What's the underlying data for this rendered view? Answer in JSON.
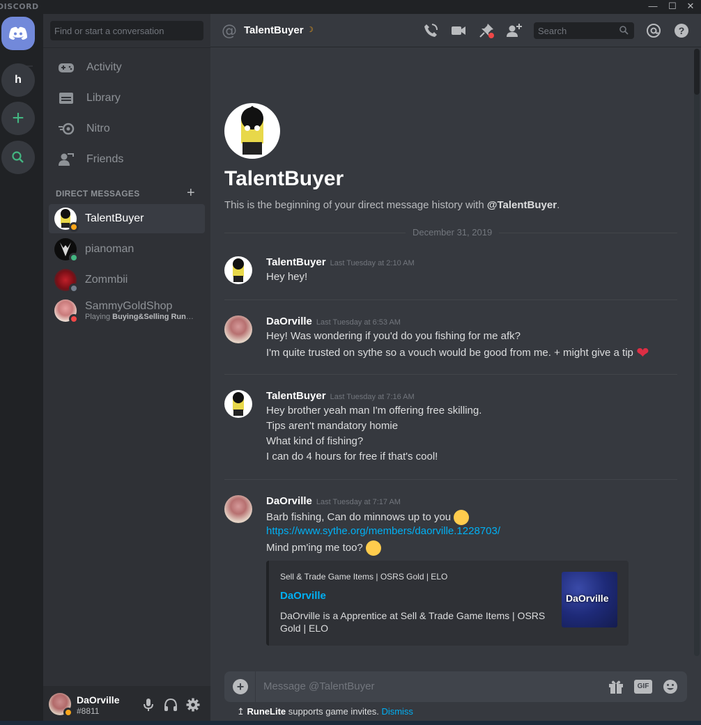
{
  "titlebar": {
    "brand": "DISCORD"
  },
  "rail": {
    "server_initial": "h"
  },
  "sidebar": {
    "search_placeholder": "Find or start a conversation",
    "nav": [
      {
        "label": "Activity",
        "icon": "gamepad-icon"
      },
      {
        "label": "Library",
        "icon": "library-icon"
      },
      {
        "label": "Nitro",
        "icon": "nitro-icon"
      },
      {
        "label": "Friends",
        "icon": "friends-icon"
      }
    ],
    "dm_header": "DIRECT MESSAGES",
    "dms": [
      {
        "name": "TalentBuyer",
        "status": "idle",
        "active": true
      },
      {
        "name": "pianoman",
        "status": "online"
      },
      {
        "name": "Zommbii",
        "status": "offline"
      },
      {
        "name": "SammyGoldShop",
        "status": "dnd",
        "sub_prefix": "Playing ",
        "sub_game": "Buying&Selling Rune..."
      }
    ]
  },
  "user": {
    "name": "DaOrville",
    "tag": "#8811"
  },
  "header": {
    "name": "TalentBuyer",
    "search_placeholder": "Search"
  },
  "intro": {
    "name": "TalentBuyer",
    "desc_prefix": "This is the beginning of your direct message history with ",
    "desc_handle": "@TalentBuyer",
    "desc_suffix": "."
  },
  "date_divider": "December 31, 2019",
  "messages": [
    {
      "author": "TalentBuyer",
      "time": "Last Tuesday at 2:10 AM",
      "lines": [
        "Hey hey!"
      ]
    },
    {
      "author": "DaOrville",
      "time": "Last Tuesday at 6:53 AM",
      "lines": [
        "Hey! Was wondering if you'd do you fishing for me afk?",
        "I'm quite trusted on sythe so a vouch would be good from me. + might give a tip "
      ]
    },
    {
      "author": "TalentBuyer",
      "time": "Last Tuesday at 7:16 AM",
      "lines": [
        "Hey brother yeah man I'm offering free skilling.",
        "Tips aren't mandatory homie",
        "What kind of fishing?",
        "I can do 4 hours for free if that's cool!"
      ]
    },
    {
      "author": "DaOrville",
      "time": "Last Tuesday at 7:17 AM",
      "lines": [
        "Barb fishing, Can do minnows up to  you ",
        "https://www.sythe.org/members/daorville.1228703/",
        "Mind pm'ing me too? "
      ]
    }
  ],
  "embed": {
    "provider": "Sell & Trade Game Items | OSRS Gold | ELO",
    "title": "DaOrville",
    "description": "DaOrville is a Apprentice at Sell & Trade Game Items | OSRS Gold | ELO",
    "thumb_text": "DaOrville"
  },
  "composer": {
    "placeholder": "Message @TalentBuyer",
    "gif_label": "GIF"
  },
  "notice": {
    "app": "RuneLite",
    "text": " supports game invites. ",
    "dismiss": "Dismiss"
  },
  "colors": {
    "accent": "#7289da",
    "online": "#43b581",
    "idle": "#faa61a",
    "dnd": "#f04747",
    "link": "#00b0f4"
  }
}
